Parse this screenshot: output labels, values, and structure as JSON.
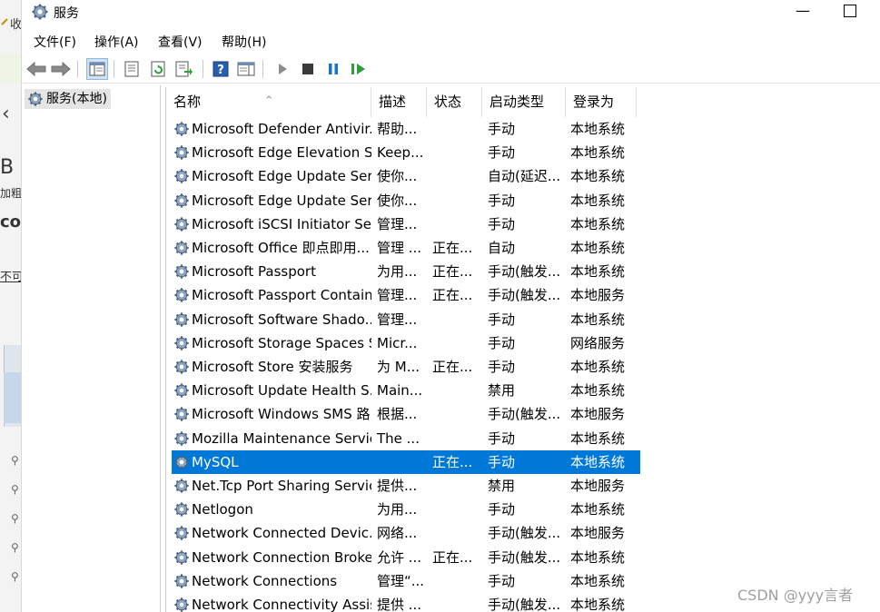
{
  "background_window": {
    "texts": [
      "收",
      "B",
      "加粗",
      "cor",
      "不可"
    ],
    "back_icon": "chevron-left-icon"
  },
  "window": {
    "title": "服务",
    "title_icon": "gear-icon",
    "controls": {
      "minimize": "—"
    }
  },
  "menu": [
    {
      "label": "文件(F)"
    },
    {
      "label": "操作(A)"
    },
    {
      "label": "查看(V)"
    },
    {
      "label": "帮助(H)"
    }
  ],
  "toolbar": {
    "icons": [
      "back-arrow-icon",
      "forward-arrow-icon",
      "console-tree-icon",
      "properties-icon",
      "refresh-icon",
      "export-list-icon",
      "help-icon",
      "show-hide-action-pane-icon",
      "start-service-icon",
      "stop-service-icon",
      "pause-service-icon",
      "restart-service-icon"
    ]
  },
  "tree": {
    "root_label": "服务(本地)"
  },
  "table": {
    "columns": [
      "名称",
      "描述",
      "状态",
      "启动类型",
      "登录为"
    ],
    "selected_index": 14,
    "rows": [
      {
        "name": "Microsoft Defender Antivir...",
        "desc": "帮助...",
        "status": "",
        "startup": "手动",
        "logon": "本地系统"
      },
      {
        "name": "Microsoft Edge Elevation S...",
        "desc": "Keep...",
        "status": "",
        "startup": "手动",
        "logon": "本地系统"
      },
      {
        "name": "Microsoft Edge Update Ser...",
        "desc": "使你...",
        "status": "",
        "startup": "自动(延迟...",
        "logon": "本地系统"
      },
      {
        "name": "Microsoft Edge Update Ser...",
        "desc": "使你...",
        "status": "",
        "startup": "手动",
        "logon": "本地系统"
      },
      {
        "name": "Microsoft iSCSI Initiator Ser...",
        "desc": "管理...",
        "status": "",
        "startup": "手动",
        "logon": "本地系统"
      },
      {
        "name": "Microsoft Office 即点即用...",
        "desc": "管理 ...",
        "status": "正在...",
        "startup": "自动",
        "logon": "本地系统"
      },
      {
        "name": "Microsoft Passport",
        "desc": "为用...",
        "status": "正在...",
        "startup": "手动(触发...",
        "logon": "本地系统"
      },
      {
        "name": "Microsoft Passport Container",
        "desc": "管理...",
        "status": "正在...",
        "startup": "手动(触发...",
        "logon": "本地服务"
      },
      {
        "name": "Microsoft Software Shado...",
        "desc": "管理...",
        "status": "",
        "startup": "手动",
        "logon": "本地系统"
      },
      {
        "name": "Microsoft Storage Spaces S...",
        "desc": "Micr...",
        "status": "",
        "startup": "手动",
        "logon": "网络服务"
      },
      {
        "name": "Microsoft Store 安装服务",
        "desc": "为 M...",
        "status": "正在...",
        "startup": "手动",
        "logon": "本地系统"
      },
      {
        "name": "Microsoft Update Health S...",
        "desc": "Main...",
        "status": "",
        "startup": "禁用",
        "logon": "本地系统"
      },
      {
        "name": "Microsoft Windows SMS 路...",
        "desc": "根据...",
        "status": "",
        "startup": "手动(触发...",
        "logon": "本地服务"
      },
      {
        "name": "Mozilla Maintenance Service",
        "desc": "The ...",
        "status": "",
        "startup": "手动",
        "logon": "本地系统"
      },
      {
        "name": "MySQL",
        "desc": "",
        "status": "正在...",
        "startup": "手动",
        "logon": "本地系统"
      },
      {
        "name": "Net.Tcp Port Sharing Service",
        "desc": "提供...",
        "status": "",
        "startup": "禁用",
        "logon": "本地服务"
      },
      {
        "name": "Netlogon",
        "desc": "为用...",
        "status": "",
        "startup": "手动",
        "logon": "本地系统"
      },
      {
        "name": "Network Connected Devic...",
        "desc": "网络...",
        "status": "",
        "startup": "手动(触发...",
        "logon": "本地服务"
      },
      {
        "name": "Network Connection Broker",
        "desc": "允许 ...",
        "status": "正在...",
        "startup": "手动(触发...",
        "logon": "本地系统"
      },
      {
        "name": "Network Connections",
        "desc": "管理“...",
        "status": "",
        "startup": "手动",
        "logon": "本地系统"
      },
      {
        "name": "Network Connectivity Assis...",
        "desc": "提供 ...",
        "status": "",
        "startup": "手动(触发...",
        "logon": "本地系统"
      }
    ]
  },
  "watermark": "CSDN @yyy言者",
  "colors": {
    "selection": "#0078d7",
    "play_green": "#2e9e3c",
    "pause_blue": "#1a73c9"
  }
}
